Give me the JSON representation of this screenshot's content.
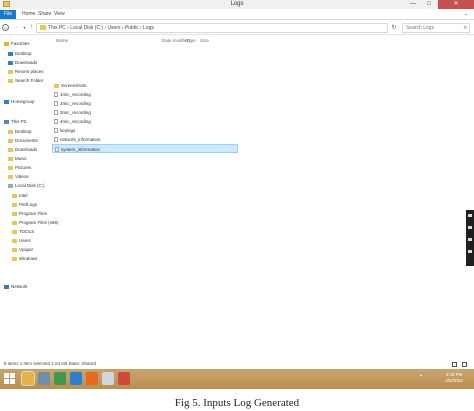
{
  "window": {
    "title": "Logs",
    "min_glyph": "—",
    "max_glyph": "□",
    "close_glyph": "✕"
  },
  "ribbon": {
    "tabs": [
      "File",
      "Home",
      "Share",
      "View"
    ],
    "expand_glyph": "⌄"
  },
  "address": {
    "path": "This PC  ›  Local Disk (C:)  ›  Users  ›  Public  ›  Logs",
    "search_placeholder": "Search Logs",
    "back_glyph": "←",
    "forward_glyph": "→",
    "recent_glyph": "▾",
    "up_glyph": "↑",
    "refresh_glyph": "↻",
    "search_icon": "⌕"
  },
  "nav_pane": {
    "favorites": {
      "label": "Favorites",
      "icon": "star-icon"
    },
    "favorite_items": [
      "Desktop",
      "Downloads",
      "Recent places",
      "Search Folder"
    ],
    "homegroup": {
      "label": "Homegroup",
      "icon": "homegroup-icon"
    },
    "this_pc": {
      "label": "This PC",
      "icon": "computer-icon"
    },
    "pc_items": [
      "Desktop",
      "Documents",
      "Downloads",
      "Music",
      "Pictures",
      "Videos"
    ],
    "drive": {
      "label": "Local Disk (C:)",
      "icon": "drive-icon"
    },
    "drive_items": [
      "Intel",
      "PerfLogs",
      "Program Files",
      "Program Files (x86)",
      "TOOLS",
      "Users",
      "Vyapar",
      "Windows"
    ],
    "network": {
      "label": "Network",
      "icon": "network-icon"
    }
  },
  "file_list": {
    "columns": [
      "Name",
      "Date modified",
      "Type",
      "Size"
    ],
    "files": [
      {
        "name": "Screenshots",
        "kind": "folder",
        "selected": false
      },
      {
        "name": "1mic_recording",
        "kind": "file",
        "selected": false
      },
      {
        "name": "2mic_recording",
        "kind": "file",
        "selected": false
      },
      {
        "name": "3mic_recording",
        "kind": "file",
        "selected": false
      },
      {
        "name": "4mic_recording",
        "kind": "file",
        "selected": false
      },
      {
        "name": "keylogs",
        "kind": "file",
        "selected": false
      },
      {
        "name": "network_information",
        "kind": "file",
        "selected": false
      },
      {
        "name": "system_information",
        "kind": "file",
        "selected": true
      }
    ]
  },
  "status_bar": {
    "text": "8 items    1 item selected  1.04 KB    State: Shared"
  },
  "taskbar": {
    "clock_time": "3:33 PM",
    "clock_date": "4/5/2022",
    "tray_glyph": "▴",
    "pinned": [
      {
        "name": "file-explorer-taskbar-icon",
        "color": "#e0b44a"
      },
      {
        "name": "store-taskbar-icon",
        "color": "#6d8fa8"
      },
      {
        "name": "chrome-taskbar-icon",
        "color": "#3d9a4b"
      },
      {
        "name": "ie-taskbar-icon",
        "color": "#2a7fd4"
      },
      {
        "name": "firefox-taskbar-icon",
        "color": "#e66a1f"
      },
      {
        "name": "file-taskbar-icon",
        "color": "#cfd6dc"
      },
      {
        "name": "media-taskbar-icon",
        "color": "#d04a3a"
      }
    ]
  },
  "caption": "Fig 5. Inputs Log Generated",
  "colors": {
    "accent": "#1979ca",
    "selection": "#cde8ff",
    "taskbar": "#c8a56e",
    "close": "#c75050"
  }
}
